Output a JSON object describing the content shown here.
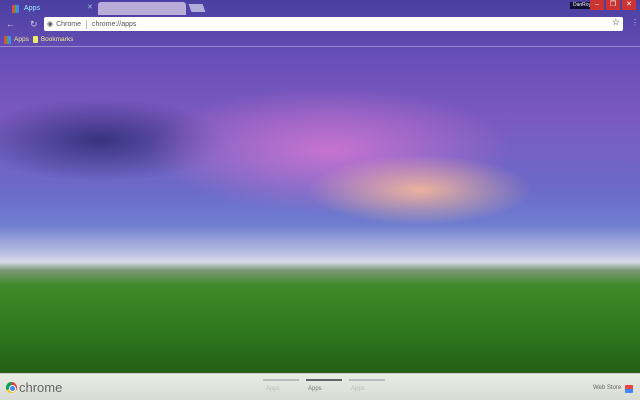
{
  "tabs": [
    {
      "label": "Apps",
      "active": true
    },
    {
      "label": "",
      "active": false
    }
  ],
  "profile_button": "DanRoy",
  "window_controls": [
    "minimize",
    "restore",
    "close"
  ],
  "omnibox": {
    "site_label": "Chrome",
    "url": "chrome://apps"
  },
  "bookmarks": [
    {
      "label": "Apps"
    },
    {
      "label": "Bookmarks"
    }
  ],
  "footer": {
    "logo_text": "chrome",
    "pages": [
      "Apps",
      "Apps",
      "Apps"
    ],
    "active_page": 1,
    "web_store": "Web Store"
  }
}
